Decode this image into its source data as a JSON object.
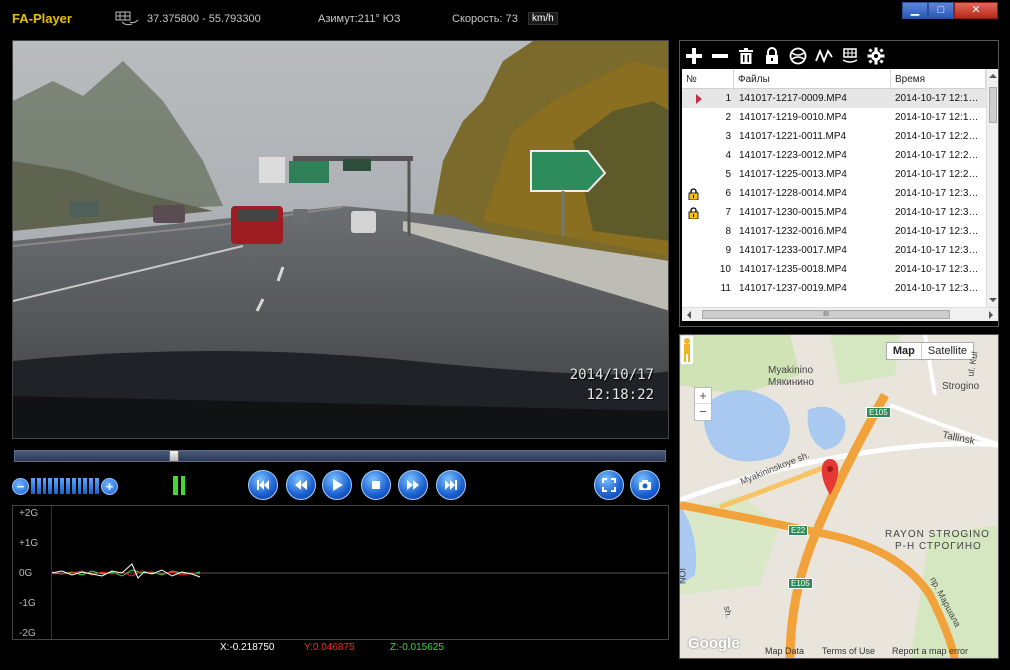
{
  "header": {
    "app_title": "FA-Player",
    "coords": "37.375800 - 55.793300",
    "azimuth": "Азимут:211° ЮЗ",
    "speed": "Скорость: 73",
    "speed_unit": "km/h"
  },
  "window_controls": {
    "minimize": "▁",
    "maximize": "□",
    "close": "✕"
  },
  "video": {
    "osd_date": "2014/10/17",
    "osd_time": "12:18:22"
  },
  "playback": {
    "position_fraction": 0.24,
    "volume_bars": 12
  },
  "gsensor": {
    "y_labels": [
      "+2G",
      "+1G",
      "0G",
      "-1G",
      "-2G"
    ],
    "x_readout": "X:-0.218750",
    "y_readout": "Y:0.046875",
    "z_readout": "Z:-0.015625",
    "colors": {
      "x": "#ffffff",
      "y": "#ff2020",
      "z": "#33dd33"
    }
  },
  "filelist": {
    "columns": {
      "num": "№",
      "files": "Файлы",
      "time": "Время"
    },
    "rows": [
      {
        "num": "1",
        "file": "141017-1217-0009.MP4",
        "time": "2014-10-17 12:1…",
        "locked": false,
        "playing": true
      },
      {
        "num": "2",
        "file": "141017-1219-0010.MP4",
        "time": "2014-10-17 12:1…",
        "locked": false,
        "playing": false
      },
      {
        "num": "3",
        "file": "141017-1221-0011.MP4",
        "time": "2014-10-17 12:2…",
        "locked": false,
        "playing": false
      },
      {
        "num": "4",
        "file": "141017-1223-0012.MP4",
        "time": "2014-10-17 12:2…",
        "locked": false,
        "playing": false
      },
      {
        "num": "5",
        "file": "141017-1225-0013.MP4",
        "time": "2014-10-17 12:2…",
        "locked": false,
        "playing": false
      },
      {
        "num": "6",
        "file": "141017-1228-0014.MP4",
        "time": "2014-10-17 12:3…",
        "locked": true,
        "playing": false
      },
      {
        "num": "7",
        "file": "141017-1230-0015.MP4",
        "time": "2014-10-17 12:3…",
        "locked": true,
        "playing": false
      },
      {
        "num": "8",
        "file": "141017-1232-0016.MP4",
        "time": "2014-10-17 12:3…",
        "locked": false,
        "playing": false
      },
      {
        "num": "9",
        "file": "141017-1233-0017.MP4",
        "time": "2014-10-17 12:3…",
        "locked": false,
        "playing": false
      },
      {
        "num": "10",
        "file": "141017-1235-0018.MP4",
        "time": "2014-10-17 12:3…",
        "locked": false,
        "playing": false
      },
      {
        "num": "11",
        "file": "141017-1237-0019.MP4",
        "time": "2014-10-17 12:3…",
        "locked": false,
        "playing": false
      }
    ],
    "hscroll_grip": "III"
  },
  "map": {
    "type_map": "Map",
    "type_satellite": "Satellite",
    "zoom_in": "+",
    "zoom_out": "−",
    "labels": {
      "myakinino_en": "Myakinino",
      "myakinino_ru": "Мякинино",
      "strogino": "Strogino",
      "tallinskaya": "Tallinsk",
      "myakininskoye": "Myakininskoye sh.",
      "rayon_en": "RAYON STROGINO",
      "rayon_ru": "Р-Н СТРОГИНО",
      "ul": "ul. Kul",
      "marshala": "пр. Маршала",
      "sh_left": "sh.",
      "ion": "ION"
    },
    "roads": [
      "E105",
      "E22",
      "E105"
    ],
    "footer": {
      "data": "Map Data",
      "terms": "Terms of Use",
      "report": "Report a map error"
    },
    "logo": "Google"
  }
}
